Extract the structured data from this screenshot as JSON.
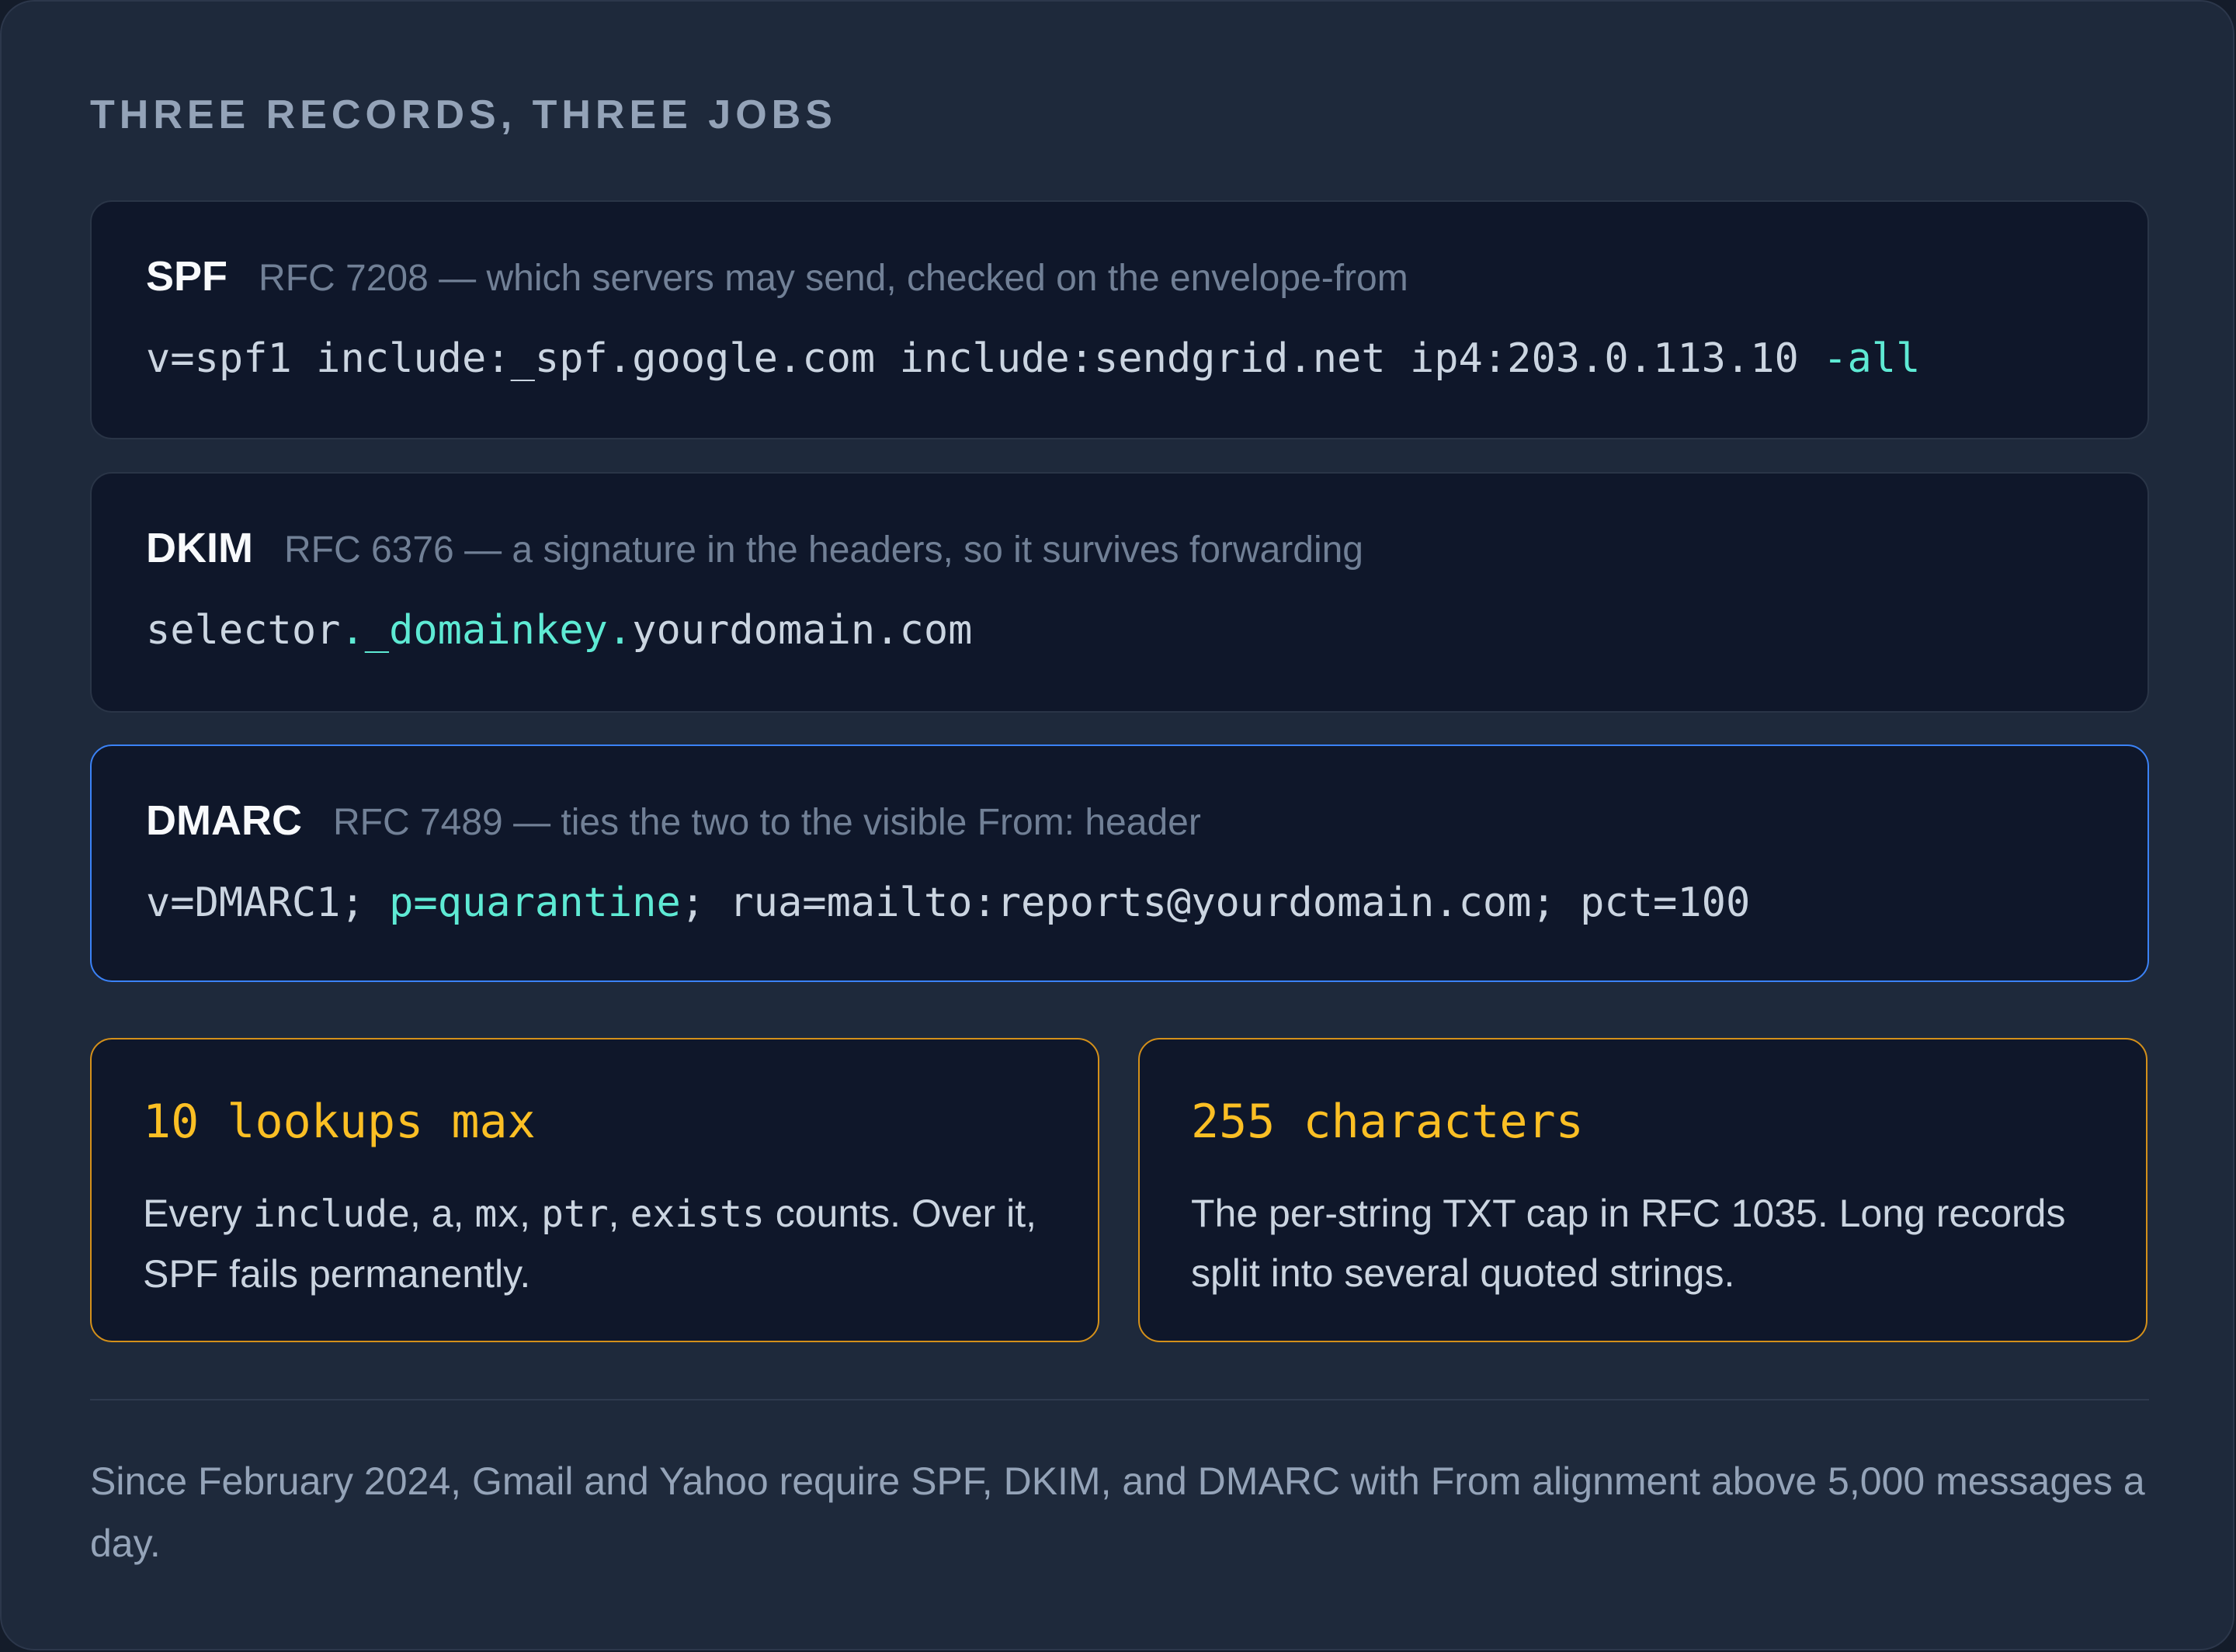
{
  "heading": "THREE RECORDS, THREE JOBS",
  "records": [
    {
      "name": "SPF",
      "description": "RFC 7208 — which servers may send, checked on the envelope-from",
      "code_parts": [
        "v=spf1 include:_spf.google.com include:sendgrid.net ip4:203.0.113.10 ",
        "-all"
      ]
    },
    {
      "name": "DKIM",
      "description": "RFC 6376 — a signature in the headers, so it survives forwarding",
      "code_parts": [
        "selector",
        "._domainkey.",
        "yourdomain.com"
      ]
    },
    {
      "name": "DMARC",
      "description": "RFC 7489 — ties the two to the visible From: header",
      "code_parts": [
        "v=DMARC1; ",
        "p=quarantine",
        "; rua=mailto:reports@yourdomain.com; pct=100"
      ]
    }
  ],
  "stats": [
    {
      "value": "10 lookups max",
      "text_parts": [
        "Every ",
        "include",
        ", a, ",
        "mx",
        ", ",
        "ptr",
        ", ",
        "exists",
        " counts. Over it, SPF fails permanently."
      ]
    },
    {
      "value": "255 characters",
      "text": "The per-string TXT cap in RFC 1035. Long records split into several quoted strings."
    }
  ],
  "footer": "Since February 2024, Gmail and Yahoo require SPF, DKIM, and DMARC with From alignment above 5,000 messages a day.",
  "colors": {
    "background": "#1e293b",
    "card": "#0f172a",
    "accent_teal": "#5eead4",
    "accent_blue": "#3b82f6",
    "accent_amber": "#fbbf24"
  }
}
